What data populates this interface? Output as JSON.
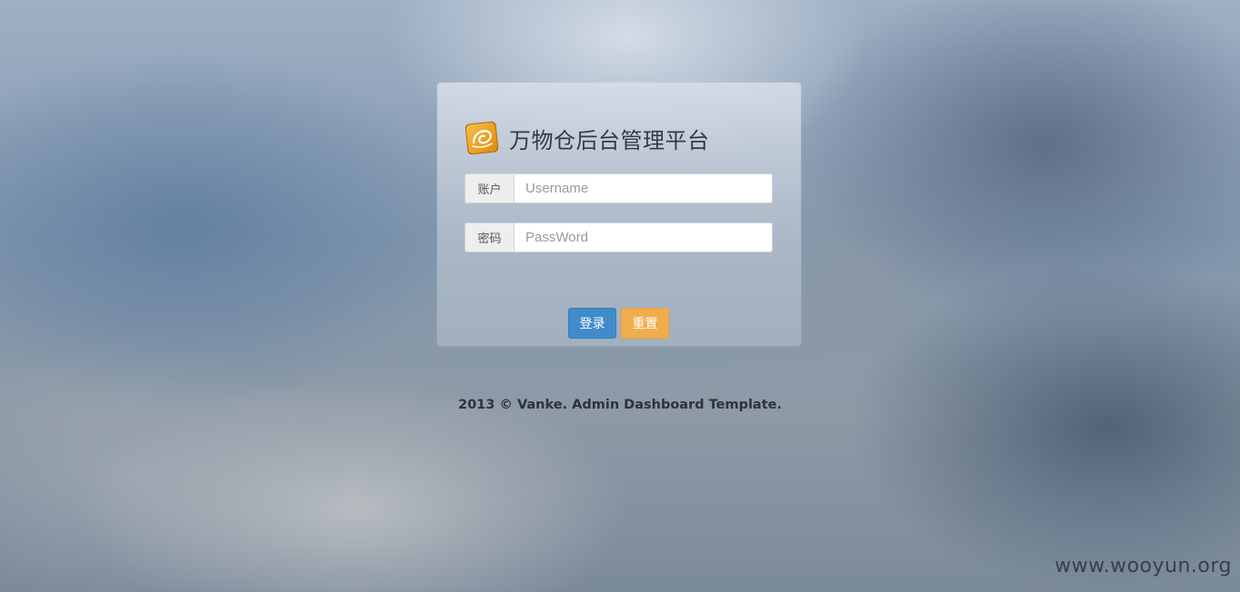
{
  "login_panel": {
    "title": "万物仓后台管理平台",
    "logo_icon": "vanke-logo-icon",
    "username": {
      "label": "账户",
      "placeholder": "Username",
      "value": ""
    },
    "password": {
      "label": "密码",
      "placeholder": "PassWord",
      "value": ""
    },
    "login_button": "登录",
    "reset_button": "重置"
  },
  "footer": {
    "text": "2013 © Vanke. Admin Dashboard Template."
  },
  "watermark": {
    "text": "www.wooyun.org"
  },
  "colors": {
    "login_button": "#428bca",
    "reset_button": "#f0ad4e",
    "logo_orange": "#f0a11c"
  }
}
